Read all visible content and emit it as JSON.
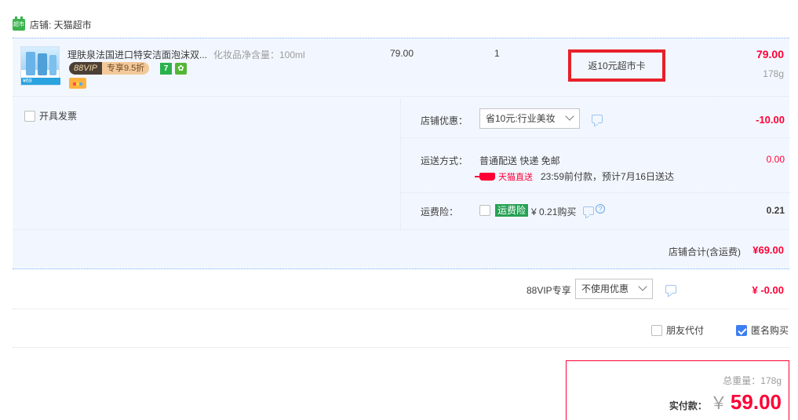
{
  "store": {
    "label": "店铺: 天猫超市",
    "icon": "tmall-supermarket-icon",
    "icon_text": "超市"
  },
  "item": {
    "title": "理肤泉法国进口特安洁面泡沫双...",
    "spec": "化妆品净含量：100ml",
    "vip_left": "88VIP",
    "vip_right": "专享9.5折",
    "seven_badge": "7",
    "shield_badge": "✿",
    "thumb_price": "¥69",
    "unit_price": "79.00",
    "quantity": "1",
    "rebate": "返10元超市卡",
    "total": "79.00",
    "weight": "178g"
  },
  "invoice": {
    "label": "开具发票",
    "checked": false
  },
  "promo": {
    "label": "店铺优惠：",
    "selected": "省10元:行业美妆",
    "amount": "-10.00"
  },
  "shipping": {
    "label": "运送方式：",
    "method": "普通配送 快递 免邮",
    "carrier": "天猫直送",
    "time": "23:59前付款，预计7月16日送达",
    "amount": "0.00"
  },
  "insurance": {
    "label": "运费险：",
    "badge": "运费险",
    "price": "¥ 0.21购买",
    "help": "?",
    "amount": "0.21",
    "checked": false
  },
  "store_total": {
    "label": "店铺合计(含运费)",
    "value": "¥69.00"
  },
  "vip": {
    "label": "88VIP专享",
    "selected": "不使用优惠",
    "amount": "¥ -0.00"
  },
  "pay_options": {
    "friend_pay": "朋友代付",
    "friend_pay_checked": false,
    "anonymous": "匿名购买",
    "anonymous_checked": true
  },
  "summary": {
    "weight": "总重量：178g",
    "pay_label": "实付款：",
    "currency": "￥",
    "amount": "59.00"
  },
  "colors": {
    "accent_red": "#ff0036",
    "highlight_border": "#e8202a",
    "link_blue": "#3d7ff2",
    "row_bg": "#f2f7ff"
  }
}
